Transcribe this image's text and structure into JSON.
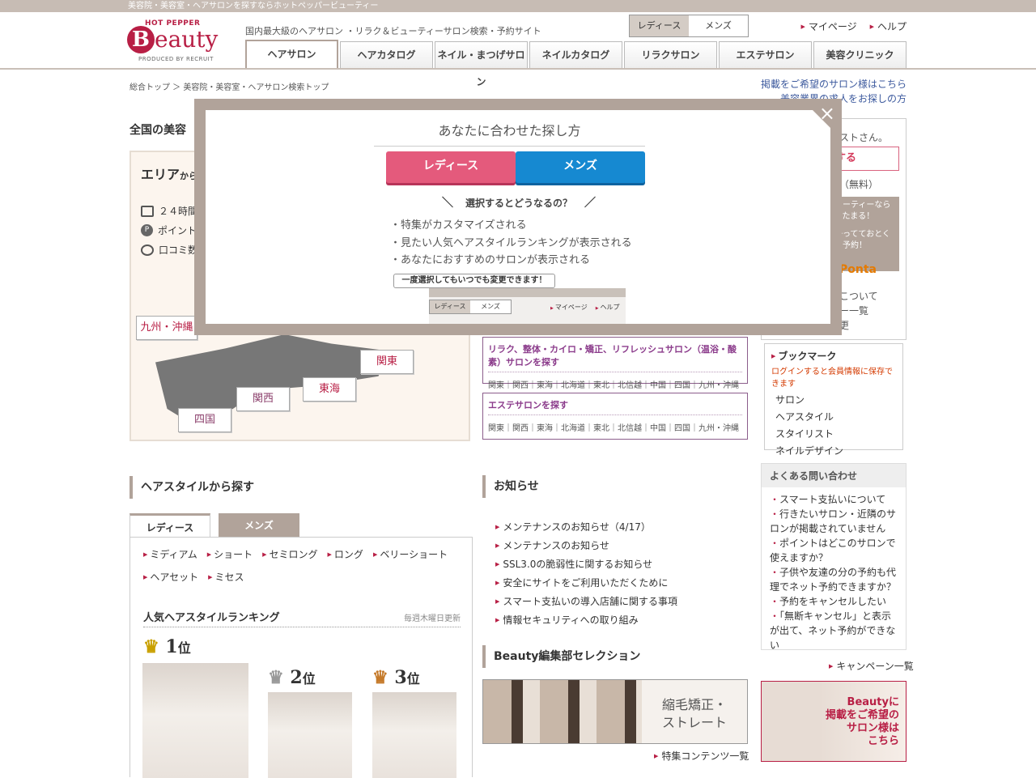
{
  "topbar": "美容院・美容室・ヘアサロンを探すならホットペッパービューティー",
  "logo": {
    "top": "HOT PEPPER",
    "b": "B",
    "rest": "eauty",
    "produced": "PRODUCED BY RECRUIT"
  },
  "header": {
    "tagline": "国内最大級のヘアサロン ・リラク＆ビューティーサロン検索・予約サイト",
    "ladies": "レディース",
    "mens": "メンズ",
    "mypage": "マイページ",
    "help": "ヘルプ"
  },
  "gnav": [
    "ヘアサロン",
    "ヘアカタログ",
    "ネイル・まつげサロン",
    "ネイルカタログ",
    "リラクサロン",
    "エステサロン",
    "美容クリニック"
  ],
  "breadcrumb": "総合トップ ＞ 美容院・美容室・ヘアサロン検索トップ",
  "rlinks": [
    "掲載をご希望のサロン様はこちら",
    "美容業界の求人をお探しの方"
  ],
  "page_title": "全国の美容",
  "area": {
    "heading": "エリア",
    "heading_small": "から",
    "feat1": "２４時間",
    "feat2": "ポイント",
    "feat3": "口コミ数",
    "kyushu": "九州・沖縄",
    "kanto": "関東",
    "tokai": "東海",
    "kansai": "関西",
    "shikoku": "四国"
  },
  "relax": {
    "title": "リラク、整体・カイロ・矯正、リフレッシュサロン（温浴・酸素）サロンを探す",
    "links": "関東｜関西｜東海｜北海道｜東北｜北信越｜中国｜四国｜九州・沖縄"
  },
  "este": {
    "title": "エステサロンを探す",
    "links": "関東｜関西｜東海｜北海道｜東北｜北信越｜中国｜四国｜九州・沖縄"
  },
  "side_partial": [
    "ストさん。",
    "する",
    "（無料）",
    "ューティーなら",
    "%たまる！",
    "かってておとく",
    "ト予約！",
    "Ponta",
    "こついて",
    "ー一覧",
    "更"
  ],
  "bookmark": {
    "title": "ブックマーク",
    "note": "ログインすると会員情報に保存できます",
    "items": [
      "サロン",
      "ヘアスタイル",
      "スタイリスト",
      "ネイルデザイン"
    ]
  },
  "faq": {
    "title": "よくある問い合わせ",
    "items": [
      "スマート支払いについて",
      "行きたいサロン・近隣のサロンが掲載されていません",
      "ポイントはどこのサロンで使えますか？",
      "子供や友達の分の予約も代理でネット予約できますか？",
      "予約をキャンセルしたい",
      "「無断キャンセル」と表示が出て、ネット予約ができない"
    ]
  },
  "campaign": "キャンペーン一覧",
  "hairstyle": {
    "heading": "ヘアスタイルから探す",
    "tab_ladies": "レディース",
    "tab_mens": "メンズ",
    "row1": [
      "ミディアム",
      "ショート",
      "セミロング",
      "ロング",
      "ベリーショート"
    ],
    "row2": [
      "ヘアセット",
      "ミセス"
    ],
    "ranking": "人気ヘアスタイルランキング",
    "update": "毎週木曜日更新",
    "r1": "1",
    "r2": "2",
    "r3": "3",
    "rank_suffix": "位"
  },
  "news": {
    "heading": "お知らせ",
    "items": [
      "メンテナンスのお知らせ（4/17）",
      "メンテナンスのお知らせ",
      "SSL3.0の脆弱性に関するお知らせ",
      "安全にサイトをご利用いただくために",
      "スマート支払いの導入店舗に関する事項",
      "情報セキュリティへの取り組み"
    ]
  },
  "selection": {
    "heading": "Beauty編集部セレクション",
    "banner_line1": "縮毛矯正・",
    "banner_line2": "ストレート",
    "more": "特集コンテンツ一覧"
  },
  "side_banner": {
    "l1": "Beautyに",
    "l2": "掲載をご希望の",
    "l3": "サロン様は",
    "l4": "こちら"
  },
  "modal": {
    "title": "あなたに合わせた探し方",
    "ladies": "レディース",
    "mens": "メンズ",
    "question": "選択するとどうなるの？",
    "items": [
      "・特集がカスタマイズされる",
      "・見たい人気ヘアスタイルランキングが表示される",
      "・あなたにおすすめのサロンが表示される"
    ],
    "note": "一度選択してもいつでも変更できます！",
    "mini_ladies": "レディース",
    "mini_mens": "メンズ",
    "mini_mypage": "マイページ",
    "mini_help": "ヘルプ",
    "close": "×"
  }
}
